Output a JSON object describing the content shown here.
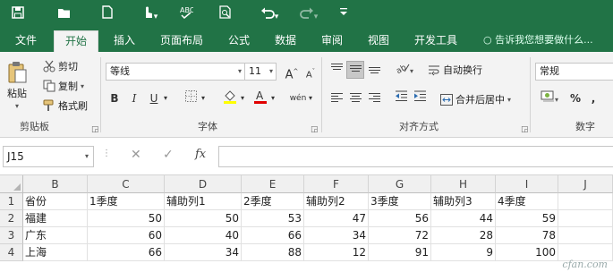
{
  "colors": {
    "accent": "#217346",
    "ribbon_bg": "#f3f3f3",
    "grid_line": "#e1e1e1"
  },
  "qat": {
    "icons": [
      "save-icon",
      "open-folder-icon",
      "new-file-icon",
      "touch-mode-icon",
      "spelling-icon",
      "print-preview-icon",
      "undo-icon",
      "redo-icon",
      "customize-qat-icon"
    ]
  },
  "tabs": [
    {
      "label": "文件"
    },
    {
      "label": "开始"
    },
    {
      "label": "插入"
    },
    {
      "label": "页面布局"
    },
    {
      "label": "公式"
    },
    {
      "label": "数据"
    },
    {
      "label": "审阅"
    },
    {
      "label": "视图"
    },
    {
      "label": "开发工具"
    }
  ],
  "active_tab": "开始",
  "tellme": "告诉我您想要做什么...",
  "ribbon": {
    "clipboard": {
      "label": "剪贴板",
      "paste": "粘贴",
      "cut": "剪切",
      "copy": "复制",
      "format_painter": "格式刷"
    },
    "font": {
      "label": "字体",
      "font_name": "等线",
      "font_size": "11",
      "grow": "A",
      "shrink": "A",
      "bold": "B",
      "italic": "I",
      "underline": "U",
      "phonetic": "wén"
    },
    "alignment": {
      "label": "对齐方式",
      "wrap_text": "自动换行",
      "merge_center": "合并后居中"
    },
    "number": {
      "label": "数字",
      "format": "常规",
      "percent": "%",
      "comma": ","
    }
  },
  "formula_bar": {
    "name_box": "J15",
    "fx": "fx",
    "value": ""
  },
  "sheet": {
    "columns": [
      "B",
      "C",
      "D",
      "E",
      "F",
      "G",
      "H",
      "I",
      "J"
    ],
    "rows": [
      {
        "num": "1",
        "cells": [
          "省份",
          "1季度",
          "辅助列1",
          "2季度",
          "辅助列2",
          "3季度",
          "辅助列3",
          "4季度",
          ""
        ]
      },
      {
        "num": "2",
        "cells": [
          "福建",
          "50",
          "50",
          "53",
          "47",
          "56",
          "44",
          "59",
          ""
        ]
      },
      {
        "num": "3",
        "cells": [
          "广东",
          "60",
          "40",
          "66",
          "34",
          "72",
          "28",
          "78",
          ""
        ]
      },
      {
        "num": "4",
        "cells": [
          "上海",
          "66",
          "34",
          "88",
          "12",
          "91",
          "9",
          "100",
          ""
        ]
      }
    ]
  },
  "watermark": "cfan.com"
}
